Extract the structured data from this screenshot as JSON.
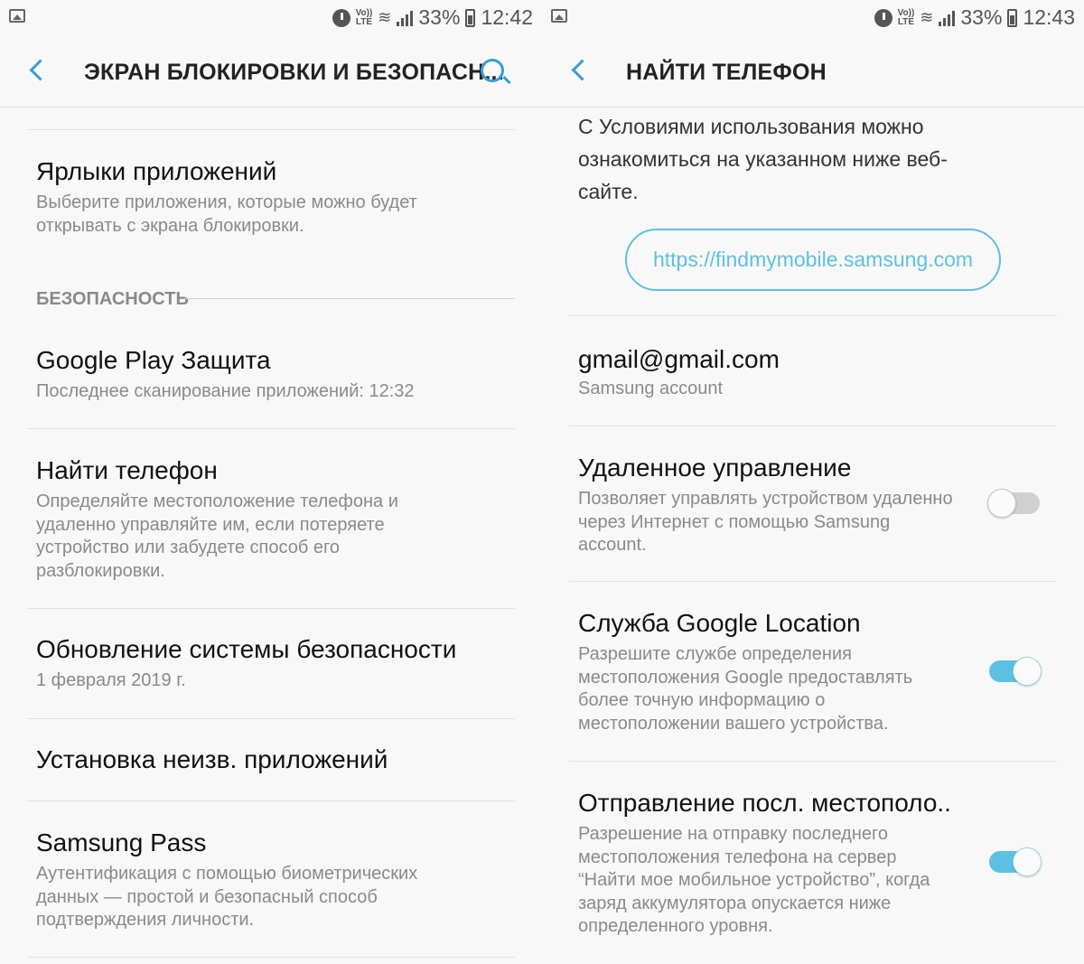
{
  "left": {
    "status": {
      "battery": "33%",
      "time": "12:42",
      "volte": "Vo)) LTE"
    },
    "title": "ЭКРАН БЛОКИРОВКИ И БЕЗОПАСН...",
    "items": [
      {
        "title": "Ярлыки приложений",
        "sub": "Выберите приложения, которые можно будет открывать с экрана блокировки."
      },
      {
        "title": "Google Play Защита",
        "sub": "Последнее сканирование приложений: 12:32"
      },
      {
        "title": "Найти телефон",
        "sub": "Определяйте местоположение телефона и удаленно управляйте им, если потеряете устройство или забудете способ его разблокировки."
      },
      {
        "title": "Обновление системы безопасности",
        "sub": "1 февраля 2019 г."
      },
      {
        "title": "Установка неизв. приложений",
        "sub": ""
      },
      {
        "title": "Samsung Pass",
        "sub": "Аутентификация с помощью биометрических данных — простой и безопасный способ подтверждения личности."
      }
    ],
    "section_header": "БЕЗОПАСНОСТЬ"
  },
  "right": {
    "status": {
      "battery": "33%",
      "time": "12:43",
      "volte": "Vo)) LTE"
    },
    "title": "НАЙТИ ТЕЛЕФОН",
    "intro": "С Условиями использования можно ознакомиться на указанном ниже веб-сайте.",
    "url": "https://findmymobile.samsung.com",
    "account": {
      "email": "gmail@gmail.com",
      "label": "Samsung account"
    },
    "items": [
      {
        "title": "Удаленное управление",
        "sub": "Позволяет управлять устройством удаленно через Интернет с помощью Samsung account.",
        "enabled": false
      },
      {
        "title": "Служба Google Location",
        "sub": "Разрешите службе определения местоположения Google предоставлять более точную информацию о местоположении вашего устройства.",
        "enabled": true
      },
      {
        "title": "Отправление посл. местополо..",
        "sub": "Разрешение на отправку последнего местоположения телефона на сервер “Найти мое мобильное устройство”, когда заряд аккумулятора опускается ниже определенного уровня.",
        "enabled": true
      }
    ]
  },
  "colors": {
    "accent": "#3a9ed1",
    "toggle_on": "#5cc1e0",
    "secondary_text": "#8a8a8a"
  }
}
